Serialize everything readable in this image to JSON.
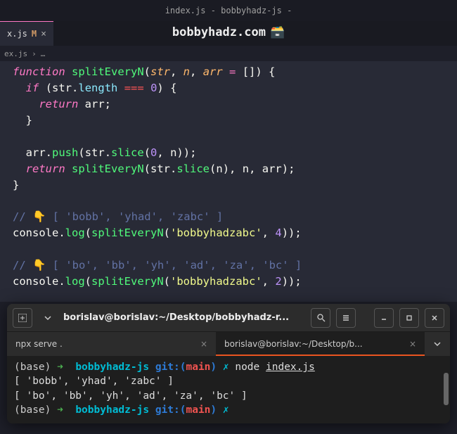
{
  "window": {
    "title": "index.js - bobbyhadz-js -"
  },
  "tabs": [
    {
      "label": "x.js",
      "modified": "M"
    }
  ],
  "watermark": "bobbyhadz.com",
  "breadcrumb": {
    "file": "ex.js",
    "sep": "›",
    "more": "…"
  },
  "code": {
    "kw_function": "function",
    "fn_name": "splitEveryN",
    "params": {
      "str": "str",
      "n": "n",
      "arr": "arr",
      "default": "[]"
    },
    "kw_if": "if",
    "prop_length": "length",
    "zero": "0",
    "kw_return": "return",
    "ident_arr": "arr",
    "method_push": "push",
    "ident_str": "str",
    "method_slice": "slice",
    "ident_n": "n",
    "comment1": "// 👇️ [ 'bobb', 'yhad', 'zabc' ]",
    "console": "console",
    "log": "log",
    "str1": "'bobbyhadzabc'",
    "four": "4",
    "comment2": "// 👇️ [ 'bo', 'bb', 'yh', 'ad', 'za', 'bc' ]",
    "two": "2"
  },
  "terminal": {
    "header_title": "borislav@borislav:~/Desktop/bobbyhadz-r...",
    "tabs": [
      {
        "label": "npx serve .",
        "active": false
      },
      {
        "label": "borislav@borislav:~/Desktop/b...",
        "active": true
      }
    ],
    "prompt": {
      "base": "(base)",
      "arrow": "➜",
      "dir": "bobbyhadz-js",
      "git": "git:",
      "branch": "main",
      "symbol": "✗"
    },
    "command": {
      "exe": "node",
      "arg": "index.js"
    },
    "output": [
      "[ 'bobb', 'yhad', 'zabc' ]",
      "[ 'bo', 'bb', 'yh', 'ad', 'za', 'bc' ]"
    ]
  }
}
